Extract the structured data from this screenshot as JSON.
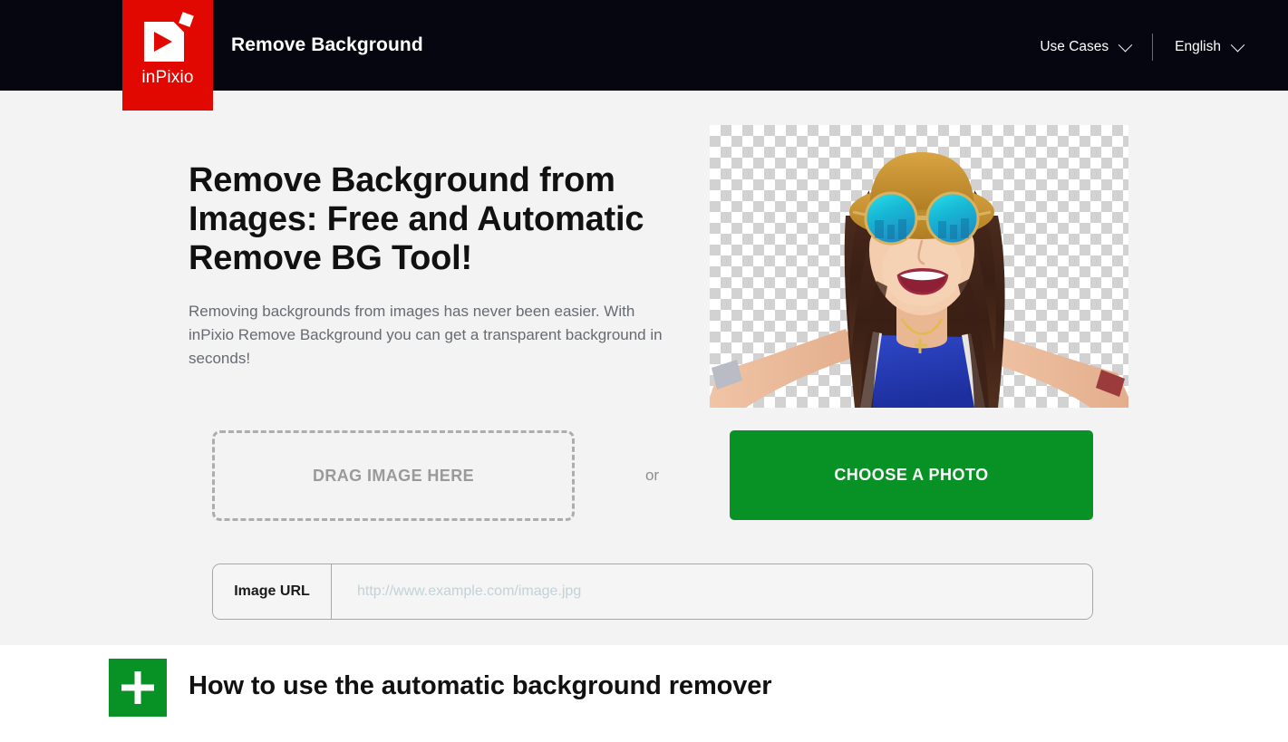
{
  "header": {
    "logo_word": "inPixio",
    "logo_icon": "inpixio-play-logo",
    "title": "Remove Background",
    "nav": [
      {
        "label": "Use Cases",
        "icon": "chevron-down-icon"
      },
      {
        "label": "English",
        "icon": "chevron-down-icon"
      }
    ]
  },
  "hero": {
    "headline": "Remove Background from Images: Free and Automatic Remove BG Tool!",
    "subtext": "Removing backgrounds from images has never been easier. With inPixio Remove Background you can get a transparent background in seconds!",
    "dropzone_label": "DRAG IMAGE HERE",
    "or_label": "or",
    "choose_button": "CHOOSE A PHOTO",
    "url_label": "Image URL",
    "url_value": "",
    "url_placeholder": "http://www.example.com/image.jpg",
    "image_alt": "Woman in straw hat and teal mirrored sunglasses taking a selfie on transparent checkerboard background"
  },
  "howto": {
    "icon": "plus-icon",
    "title": "How to use the automatic background remover"
  },
  "colors": {
    "header_background": "#05060f",
    "logo_red": "#e00800",
    "accent_green": "#089226",
    "hero_background": "#f3f3f3",
    "dropzone_border": "#adadad",
    "placeholder_text": "#c2d2d8"
  }
}
